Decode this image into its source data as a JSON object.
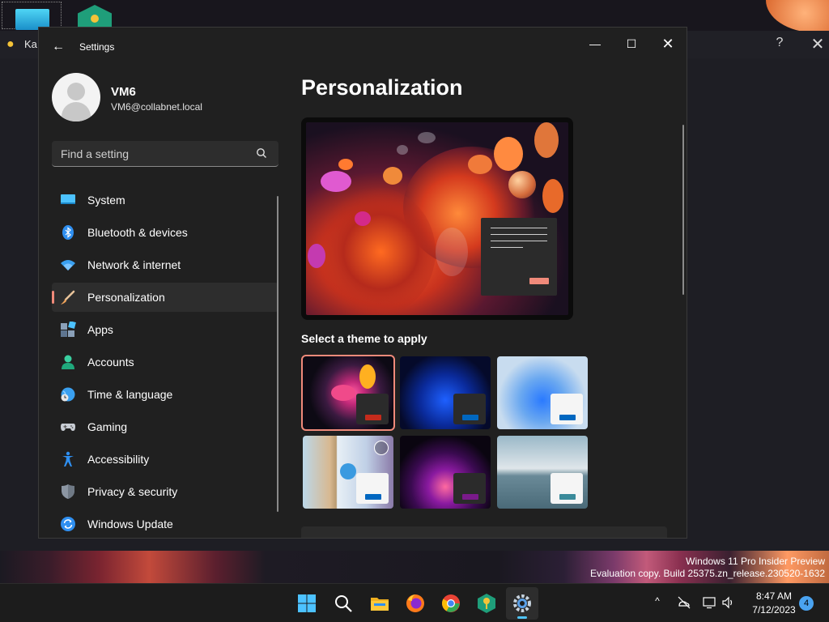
{
  "desktop": {
    "background_app": {
      "title": "Ka",
      "help_label": "?",
      "close_label": "✕"
    },
    "watermark": {
      "line1": "Windows 11 Pro Insider Preview",
      "line2": "Evaluation copy. Build 25375.zn_release.230520-1632"
    }
  },
  "settings": {
    "window_title": "Settings",
    "back_label": "←",
    "min_label": "—",
    "max_label": "☐",
    "close_label": "✕",
    "user": {
      "name": "VM6",
      "email": "VM6@collabnet.local"
    },
    "search": {
      "placeholder": "Find a setting"
    },
    "nav": [
      {
        "label": "System",
        "icon": "system-icon"
      },
      {
        "label": "Bluetooth & devices",
        "icon": "bluetooth-icon"
      },
      {
        "label": "Network & internet",
        "icon": "wifi-icon"
      },
      {
        "label": "Personalization",
        "icon": "brush-icon",
        "active": true
      },
      {
        "label": "Apps",
        "icon": "apps-icon"
      },
      {
        "label": "Accounts",
        "icon": "accounts-icon"
      },
      {
        "label": "Time & language",
        "icon": "globe-clock-icon"
      },
      {
        "label": "Gaming",
        "icon": "controller-icon"
      },
      {
        "label": "Accessibility",
        "icon": "accessibility-icon"
      },
      {
        "label": "Privacy & security",
        "icon": "shield-icon"
      },
      {
        "label": "Windows Update",
        "icon": "update-icon"
      }
    ],
    "page_title": "Personalization",
    "themes_label": "Select a theme to apply",
    "themes": [
      {
        "name": "glow",
        "accent": "#c42b1c",
        "selected": true
      },
      {
        "name": "windows-dark",
        "accent": "#0067c0"
      },
      {
        "name": "windows-light",
        "accent": "#0067c0"
      },
      {
        "name": "spotlight",
        "accent": "#0067c0"
      },
      {
        "name": "captured-motion",
        "accent": "#7a1a8a"
      },
      {
        "name": "sunrise-flow",
        "accent": "#3a8a9a"
      }
    ]
  },
  "taskbar": {
    "apps": [
      "start-icon",
      "search-icon",
      "file-explorer-icon",
      "firefox-icon",
      "chrome-icon",
      "keepass-icon",
      "settings-icon"
    ],
    "active_app": "settings-icon",
    "tray_chevron": "^",
    "clock": {
      "time": "8:47 AM",
      "date": "7/12/2023"
    },
    "notification_count": "4"
  },
  "colors": {
    "accent": "#f08a7a",
    "taskbar_indicator": "#4fc3f7"
  }
}
